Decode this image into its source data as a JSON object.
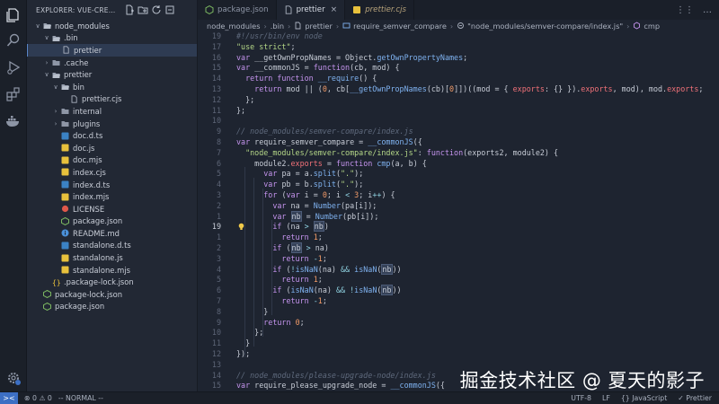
{
  "explorer": {
    "title": "EXPLORER: VUE-CREAT...",
    "tools": [
      "new-file-icon",
      "new-folder-icon",
      "refresh-icon",
      "collapse-icon"
    ]
  },
  "tree": [
    {
      "label": "node_modules",
      "kind": "folder-open",
      "depth": 0,
      "chev": "∨"
    },
    {
      "label": ".bin",
      "kind": "folder-open",
      "depth": 1,
      "chev": "∨"
    },
    {
      "label": "prettier",
      "kind": "file-generic",
      "depth": 2,
      "chev": "",
      "selected": true
    },
    {
      "label": ".cache",
      "kind": "folder",
      "depth": 1,
      "chev": "›"
    },
    {
      "label": "prettier",
      "kind": "folder-open",
      "depth": 1,
      "chev": "∨"
    },
    {
      "label": "bin",
      "kind": "folder-open",
      "depth": 2,
      "chev": "∨"
    },
    {
      "label": "prettier.cjs",
      "kind": "file-generic",
      "depth": 3,
      "chev": ""
    },
    {
      "label": "internal",
      "kind": "folder",
      "depth": 2,
      "chev": "›"
    },
    {
      "label": "plugins",
      "kind": "folder",
      "depth": 2,
      "chev": "›"
    },
    {
      "label": "doc.d.ts",
      "kind": "file-ts",
      "depth": 2,
      "chev": ""
    },
    {
      "label": "doc.js",
      "kind": "file-js",
      "depth": 2,
      "chev": ""
    },
    {
      "label": "doc.mjs",
      "kind": "file-js",
      "depth": 2,
      "chev": ""
    },
    {
      "label": "index.cjs",
      "kind": "file-js",
      "depth": 2,
      "chev": ""
    },
    {
      "label": "index.d.ts",
      "kind": "file-ts",
      "depth": 2,
      "chev": ""
    },
    {
      "label": "index.mjs",
      "kind": "file-js",
      "depth": 2,
      "chev": ""
    },
    {
      "label": "LICENSE",
      "kind": "file-license",
      "depth": 2,
      "chev": ""
    },
    {
      "label": "package.json",
      "kind": "file-json-green",
      "depth": 2,
      "chev": ""
    },
    {
      "label": "README.md",
      "kind": "file-info",
      "depth": 2,
      "chev": ""
    },
    {
      "label": "standalone.d.ts",
      "kind": "file-ts",
      "depth": 2,
      "chev": ""
    },
    {
      "label": "standalone.js",
      "kind": "file-js",
      "depth": 2,
      "chev": ""
    },
    {
      "label": "standalone.mjs",
      "kind": "file-js",
      "depth": 2,
      "chev": ""
    },
    {
      "label": ".package-lock.json",
      "kind": "file-braces",
      "depth": 1,
      "chev": ""
    },
    {
      "label": "package-lock.json",
      "kind": "file-json-green",
      "depth": 0,
      "chev": ""
    },
    {
      "label": "package.json",
      "kind": "file-json-green",
      "depth": 0,
      "chev": ""
    }
  ],
  "tabs": [
    {
      "label": "package.json",
      "icon": "json-file-icon",
      "active": false,
      "italic": false
    },
    {
      "label": "prettier",
      "icon": "file-icon",
      "active": true,
      "italic": false,
      "close": "×"
    },
    {
      "label": "prettier.cjs",
      "icon": "js-file-icon",
      "active": false,
      "italic": true
    }
  ],
  "tab_actions": [
    "⋮⋮",
    "…"
  ],
  "breadcrumb": [
    "node_modules",
    ".bin",
    "prettier",
    "require_semver_compare",
    "\"node_modules/semver-compare/index.js\"",
    "cmp"
  ],
  "code": {
    "current_line": 19,
    "lines": [
      {
        "n": "19",
        "html": "<span class='cm'>#!/usr/bin/env node</span>"
      },
      {
        "n": "17",
        "html": "<span class='str'>\"use strict\"</span>;"
      },
      {
        "n": "16",
        "html": "<span class='kw'>var</span> __getOwnPropNames = Object.<span class='fn'>getOwnPropertyNames</span>;"
      },
      {
        "n": "15",
        "html": "<span class='kw'>var</span> __commonJS = <span class='kw'>function</span>(cb, mod) {"
      },
      {
        "n": "14",
        "html": "  <span class='kw'>return function</span> <span class='fn'>__require</span>() {"
      },
      {
        "n": "13",
        "html": "    <span class='kw'>return</span> mod || (<span class='num'>0</span>, cb[<span class='fn'>__getOwnPropNames</span>(cb)[<span class='num'>0</span>]])((mod = { <span class='pr'>exports</span>: {} }).<span class='pr'>exports</span>, mod), mod.<span class='pr'>exports</span>;"
      },
      {
        "n": "12",
        "html": "  };"
      },
      {
        "n": "11",
        "html": "};"
      },
      {
        "n": "10",
        "html": ""
      },
      {
        "n": "9",
        "html": "<span class='cm'>// node_modules/semver-compare/index.js</span>"
      },
      {
        "n": "8",
        "html": "<span class='kw'>var</span> require_semver_compare = <span class='fn'>__commonJS</span>({"
      },
      {
        "n": "7",
        "html": "  <span class='str'>\"node_modules/semver-compare/index.js\"</span>: <span class='kw'>function</span>(exports2, module2) {"
      },
      {
        "n": "6",
        "html": "    module2.<span class='pr'>exports</span> = <span class='kw'>function</span> <span class='fn'>cmp</span>(a, b) {"
      },
      {
        "n": "5",
        "html": "      <span class='kw'>var</span> pa = a.<span class='fn'>split</span>(<span class='str'>\".\"</span>);"
      },
      {
        "n": "4",
        "html": "      <span class='kw'>var</span> pb = b.<span class='fn'>split</span>(<span class='str'>\".\"</span>);"
      },
      {
        "n": "3",
        "html": "      <span class='kw'>for</span> (<span class='kw'>var</span> i = <span class='num'>0</span>; i <span class='op'>&lt;</span> <span class='num'>3</span>; i<span class='op'>++</span>) {"
      },
      {
        "n": "2",
        "html": "        <span class='kw'>var</span> na = <span class='fn'>Number</span>(pa[i]);"
      },
      {
        "n": "1",
        "html": "        <span class='kw'>var</span> <span class='hl'>nb</span> = <span class='fn'>Number</span>(pb[i]);"
      },
      {
        "n": "19",
        "html": "        <span class='kw'>if</span> (na <span class='op'>&gt;</span> <span class='hl'>nb</span>)"
      },
      {
        "n": "1",
        "html": "          <span class='kw'>return</span> <span class='num'>1</span>;"
      },
      {
        "n": "2",
        "html": "        <span class='kw'>if</span> (<span class='hl'>nb</span> <span class='op'>&gt;</span> na)"
      },
      {
        "n": "3",
        "html": "          <span class='kw'>return</span> <span class='op'>-</span><span class='num'>1</span>;"
      },
      {
        "n": "4",
        "html": "        <span class='kw'>if</span> (<span class='op'>!</span><span class='fn'>isNaN</span>(na) <span class='op'>&amp;&amp;</span> <span class='fn'>isNaN</span>(<span class='hl'>nb</span>))"
      },
      {
        "n": "5",
        "html": "          <span class='kw'>return</span> <span class='num'>1</span>;"
      },
      {
        "n": "6",
        "html": "        <span class='kw'>if</span> (<span class='fn'>isNaN</span>(na) <span class='op'>&amp;&amp;</span> <span class='op'>!</span><span class='fn'>isNaN</span>(<span class='hl'>nb</span>))"
      },
      {
        "n": "7",
        "html": "          <span class='kw'>return</span> <span class='op'>-</span><span class='num'>1</span>;"
      },
      {
        "n": "8",
        "html": "      }"
      },
      {
        "n": "9",
        "html": "      <span class='kw'>return</span> <span class='num'>0</span>;"
      },
      {
        "n": "10",
        "html": "    };"
      },
      {
        "n": "11",
        "html": "  }"
      },
      {
        "n": "12",
        "html": "});"
      },
      {
        "n": "13",
        "html": ""
      },
      {
        "n": "14",
        "html": "<span class='cm'>// node_modules/please-upgrade-node/index.js</span>"
      },
      {
        "n": "15",
        "html": "<span class='kw'>var</span> require_please_upgrade_node = <span class='fn'>__commonJS</span>({"
      }
    ]
  },
  "watermark": "掘金技术社区 @ 夏天的影子",
  "status": {
    "remote": "><",
    "problems": "⊗ 0 ⚠ 0",
    "mode": "-- NORMAL --",
    "right": [
      "UTF-8",
      "LF",
      "{} JavaScript",
      "✓ Prettier"
    ]
  },
  "colors": {
    "activity_bar": "#1b2029",
    "sidebar": "#222834",
    "editor": "#1e2430",
    "accent": "#3c6fc4"
  }
}
